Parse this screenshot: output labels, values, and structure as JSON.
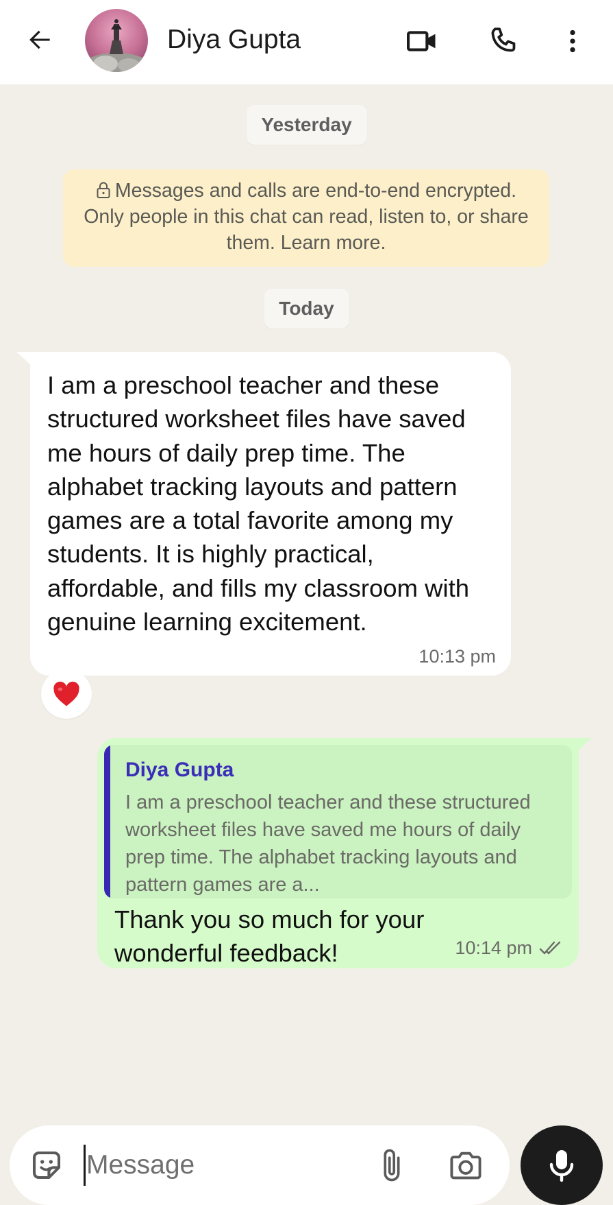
{
  "header": {
    "contact_name": "Diya Gupta",
    "back_icon": "arrow-left-icon",
    "video_icon": "video-camera-icon",
    "call_icon": "phone-icon",
    "menu_icon": "more-vertical-icon"
  },
  "chat": {
    "date_yesterday": "Yesterday",
    "encryption_notice": "Messages and calls are end-to-end encrypted. Only people in this chat can read, listen to, or share them. Learn more.",
    "date_today": "Today",
    "messages": [
      {
        "direction": "incoming",
        "text": "I am a preschool teacher and these structured worksheet files have saved me hours of daily prep time. The alphabet tracking layouts and pattern games are a total favorite among my students. It is highly practical, affordable, and fills my classroom with genuine learning excitement.",
        "time": "10:13 pm",
        "reaction": "❤️"
      },
      {
        "direction": "outgoing",
        "quote_author": "Diya Gupta",
        "quote_text": "I am a preschool teacher and these structured worksheet files have saved me hours of daily prep time. The alphabet tracking layouts and pattern games are a...",
        "text": "Thank you so much for your wonderful feedback!",
        "time": "10:14 pm",
        "status": "read"
      }
    ]
  },
  "composer": {
    "placeholder": "Message",
    "emoji_icon": "sticker-icon",
    "attach_icon": "paperclip-icon",
    "camera_icon": "camera-icon",
    "mic_icon": "microphone-icon"
  },
  "colors": {
    "chat_background": "#f2efe9",
    "incoming_bubble": "#ffffff",
    "outgoing_bubble": "#d6fbcb",
    "quote_bar": "#3928b4",
    "encryption_banner": "#fcefc9",
    "mic_button": "#1b1c1b"
  }
}
